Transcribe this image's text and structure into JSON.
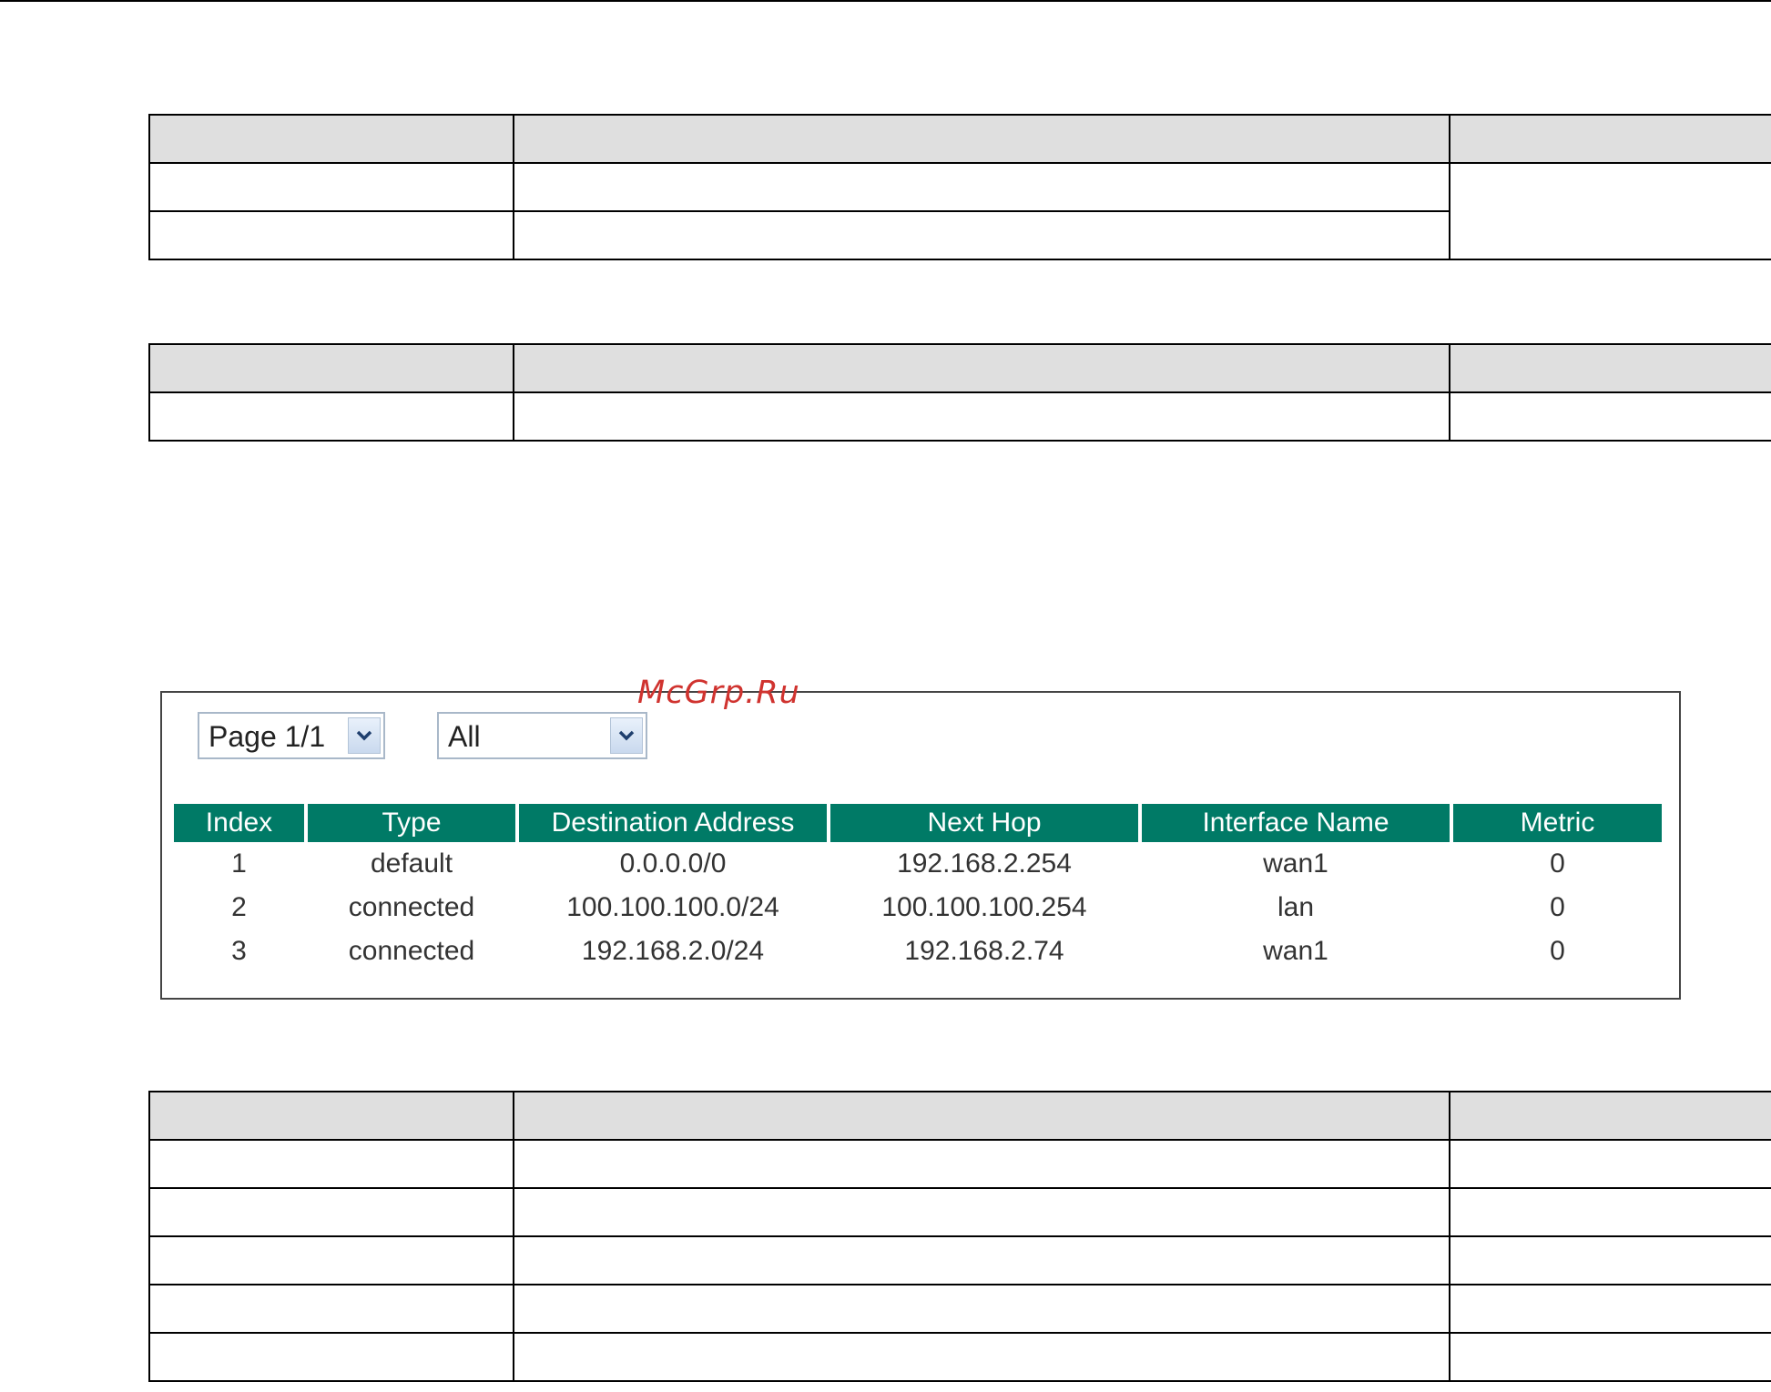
{
  "doc_tables": {
    "table1": {
      "header": [
        "",
        "",
        ""
      ],
      "rows": [
        [
          "",
          "",
          ""
        ],
        [
          "",
          ""
        ]
      ]
    },
    "table2": {
      "header": [
        "",
        "",
        ""
      ],
      "rows": [
        [
          "",
          "",
          ""
        ]
      ]
    },
    "table3": {
      "header": [
        "",
        "",
        ""
      ],
      "rows": [
        [
          "",
          "",
          ""
        ],
        [
          "",
          "",
          ""
        ],
        [
          "",
          "",
          ""
        ],
        [
          "",
          "",
          ""
        ],
        [
          "",
          "",
          ""
        ]
      ]
    }
  },
  "watermark": "McGrp.Ru",
  "routing_panel": {
    "page_select": {
      "value": "Page 1/1"
    },
    "filter_select": {
      "value": "All"
    },
    "columns": [
      "Index",
      "Type",
      "Destination Address",
      "Next Hop",
      "Interface Name",
      "Metric"
    ],
    "rows": [
      [
        "1",
        "default",
        "0.0.0.0/0",
        "192.168.2.254",
        "wan1",
        "0"
      ],
      [
        "2",
        "connected",
        "100.100.100.0/24",
        "100.100.100.254",
        "lan",
        "0"
      ],
      [
        "3",
        "connected",
        "192.168.2.0/24",
        "192.168.2.74",
        "wan1",
        "0"
      ]
    ],
    "header_color": "#007a66"
  }
}
